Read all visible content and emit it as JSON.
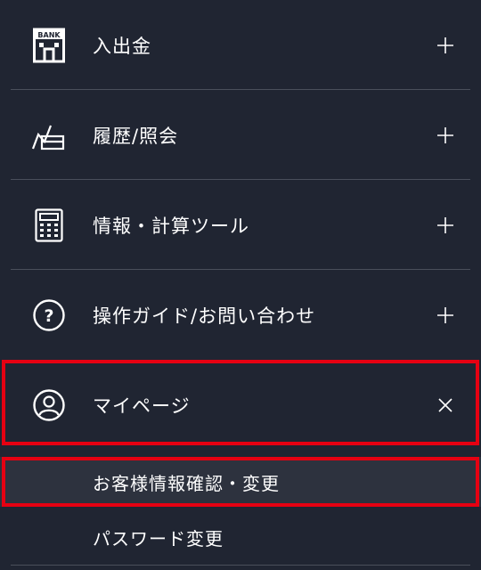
{
  "menu": {
    "items": [
      {
        "label": "入出金",
        "icon": "bank-icon",
        "toggle": "plus-icon"
      },
      {
        "label": "履歴/照会",
        "icon": "history-chart-icon",
        "toggle": "plus-icon"
      },
      {
        "label": "情報・計算ツール",
        "icon": "calculator-icon",
        "toggle": "plus-icon"
      },
      {
        "label": "操作ガイド/お問い合わせ",
        "icon": "question-icon",
        "toggle": "plus-icon"
      },
      {
        "label": "マイページ",
        "icon": "user-icon",
        "toggle": "close-icon",
        "expanded": true
      }
    ],
    "bank_icon_text": "BANK",
    "question_icon_text": "?",
    "submenu": [
      {
        "label": "お客様情報確認・変更"
      },
      {
        "label": "パスワード変更"
      }
    ]
  },
  "colors": {
    "background": "#202532",
    "sub_highlight_bg": "#2d323e",
    "divider": "#4a4f5b",
    "highlight_border": "#e60012",
    "text": "#ffffff"
  }
}
